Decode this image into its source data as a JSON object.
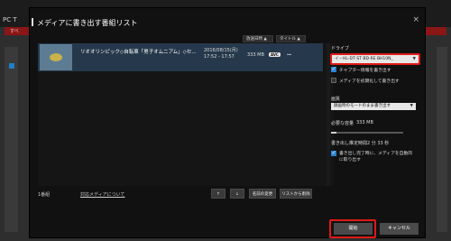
{
  "background": {
    "app_title": "PC T",
    "bar_label": "すべ"
  },
  "dialog": {
    "title": "メディアに書き出す番組リスト",
    "close_icon": "×",
    "sort": {
      "date_label": "放送日時 ▲",
      "title_label": "タイトル ▲"
    },
    "program": {
      "name": "リオオリンピック◇自転車「男子オムニアム」◇セ...",
      "date_line1": "2016/08/15(月)",
      "date_line2": "17:52 ‐ 17:57",
      "size": "333 MB",
      "badge": "AVC",
      "format_icon": "⊶"
    },
    "count": "1番組",
    "media_link": "対応メディアについて",
    "buttons": {
      "up": "↑",
      "down": "↓",
      "rename": "名前の変更",
      "remove": "リストから削除",
      "start": "開始",
      "cancel": "キャンセル"
    },
    "right": {
      "drive_label": "ドライブ",
      "drive_value": "イ－HL‐DT‐ST BD‐RE BH10N_",
      "chapter_label": "チャプター情報を書き出す",
      "init_label": "メディアを初期化して書き出す",
      "quality_label": "画質",
      "quality_value": "録画時のモードのまま書き出す",
      "capacity_label": "必要な容量",
      "capacity_value": "333 MB",
      "capacity_fraction": 0.08,
      "time_label": "書き出し推定時間",
      "time_value": "2 分 33 秒",
      "eject_label_1": "書き出し完了時に、メディアを自動的",
      "eject_label_2": "に取り出す"
    }
  }
}
